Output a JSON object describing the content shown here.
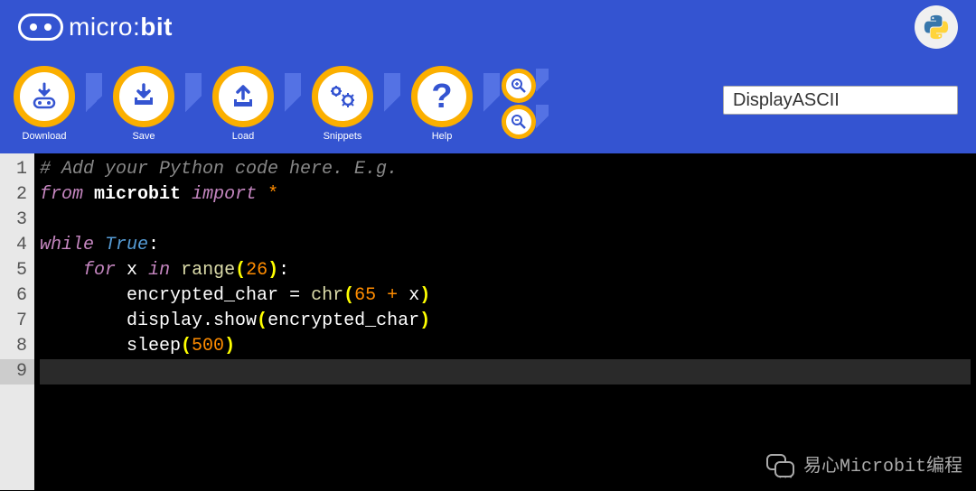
{
  "header": {
    "logo_text_thin": "micro:",
    "logo_text_bold": "bit"
  },
  "toolbar": {
    "download": "Download",
    "save": "Save",
    "load": "Load",
    "snippets": "Snippets",
    "help": "Help"
  },
  "filename": "DisplayASCII",
  "code": {
    "lines": [
      "1",
      "2",
      "3",
      "4",
      "5",
      "6",
      "7",
      "8",
      "9"
    ],
    "l1_comment": "# Add your Python code here. E.g.",
    "l2_from": "from",
    "l2_mod": "microbit",
    "l2_import": "import",
    "l2_star": "*",
    "l4_while": "while",
    "l4_true": "True",
    "l5_for": "for",
    "l5_x": "x",
    "l5_in": "in",
    "l5_range": "range",
    "l5_26": "26",
    "l6_var": "encrypted_char",
    "l6_chr": "chr",
    "l6_65": "65",
    "l6_plus": "+",
    "l6_x": "x",
    "l7_call": "display.show",
    "l7_arg": "encrypted_char",
    "l8_sleep": "sleep",
    "l8_500": "500"
  },
  "watermark": "易心Microbit编程"
}
